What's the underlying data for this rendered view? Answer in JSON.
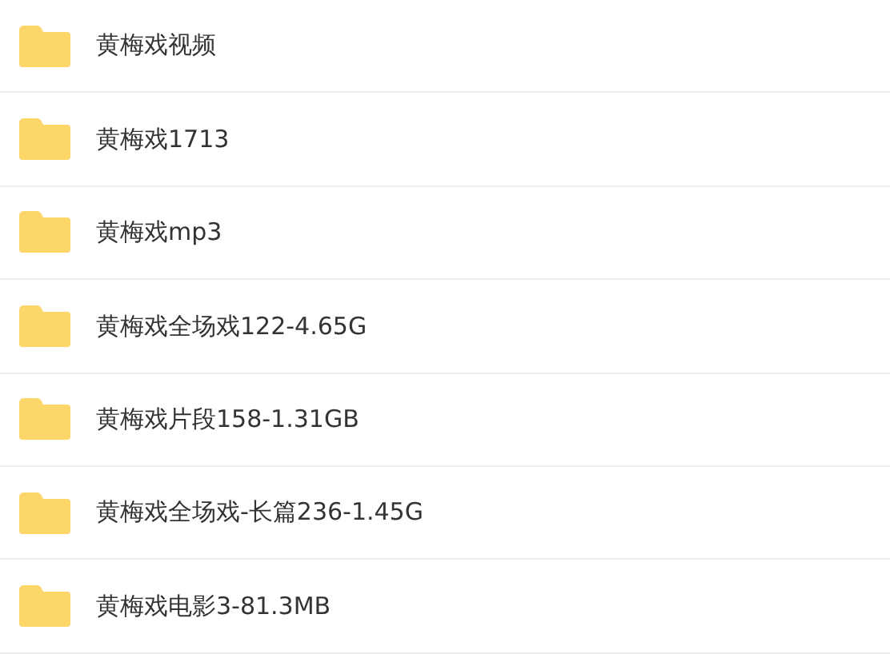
{
  "folders": [
    {
      "name": "黄梅戏视频"
    },
    {
      "name": "黄梅戏1713"
    },
    {
      "name": "黄梅戏mp3"
    },
    {
      "name": "黄梅戏全场戏122-4.65G"
    },
    {
      "name": "黄梅戏片段158-1.31GB"
    },
    {
      "name": "黄梅戏全场戏-长篇236-1.45G"
    },
    {
      "name": "黄梅戏电影3-81.3MB"
    }
  ]
}
